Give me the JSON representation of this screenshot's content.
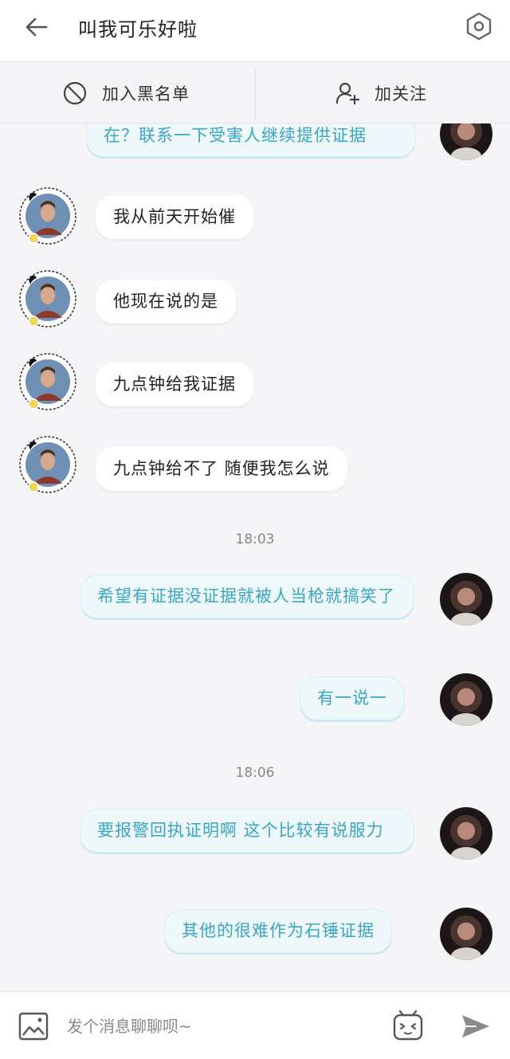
{
  "header": {
    "title": "叫我可乐好啦",
    "back_icon": "back-arrow-icon",
    "settings_icon": "settings-hexagon-icon"
  },
  "actions": {
    "blacklist_label": "加入黑名单",
    "follow_label": "加关注"
  },
  "messages": [
    {
      "side": "out",
      "text": "在？联系一下受害人继续提供证据"
    },
    {
      "side": "in",
      "text": "我从前天开始催"
    },
    {
      "side": "in",
      "text": "他现在说的是"
    },
    {
      "side": "in",
      "text": "九点钟给我证据"
    },
    {
      "side": "in",
      "text": "九点钟给不了 随便我怎么说"
    },
    {
      "side": "out",
      "text": "希望有证据没证据就被人当枪就搞笑了"
    },
    {
      "side": "out",
      "text": "有一说一"
    },
    {
      "side": "out",
      "text": "要报警回执证明啊 这个比较有说服力"
    },
    {
      "side": "out",
      "text": "其他的很难作为石锤证据"
    }
  ],
  "timestamps": [
    "18:03",
    "18:06"
  ],
  "composer": {
    "placeholder": "发个消息聊聊呗~",
    "image_icon": "image-icon",
    "emoji_icon": "emoji-face-icon",
    "send_icon": "send-icon"
  },
  "colors": {
    "outgoing_text": "#3aa6c4",
    "outgoing_bg": "#eef8fb",
    "page_bg": "#f5f5f7"
  }
}
